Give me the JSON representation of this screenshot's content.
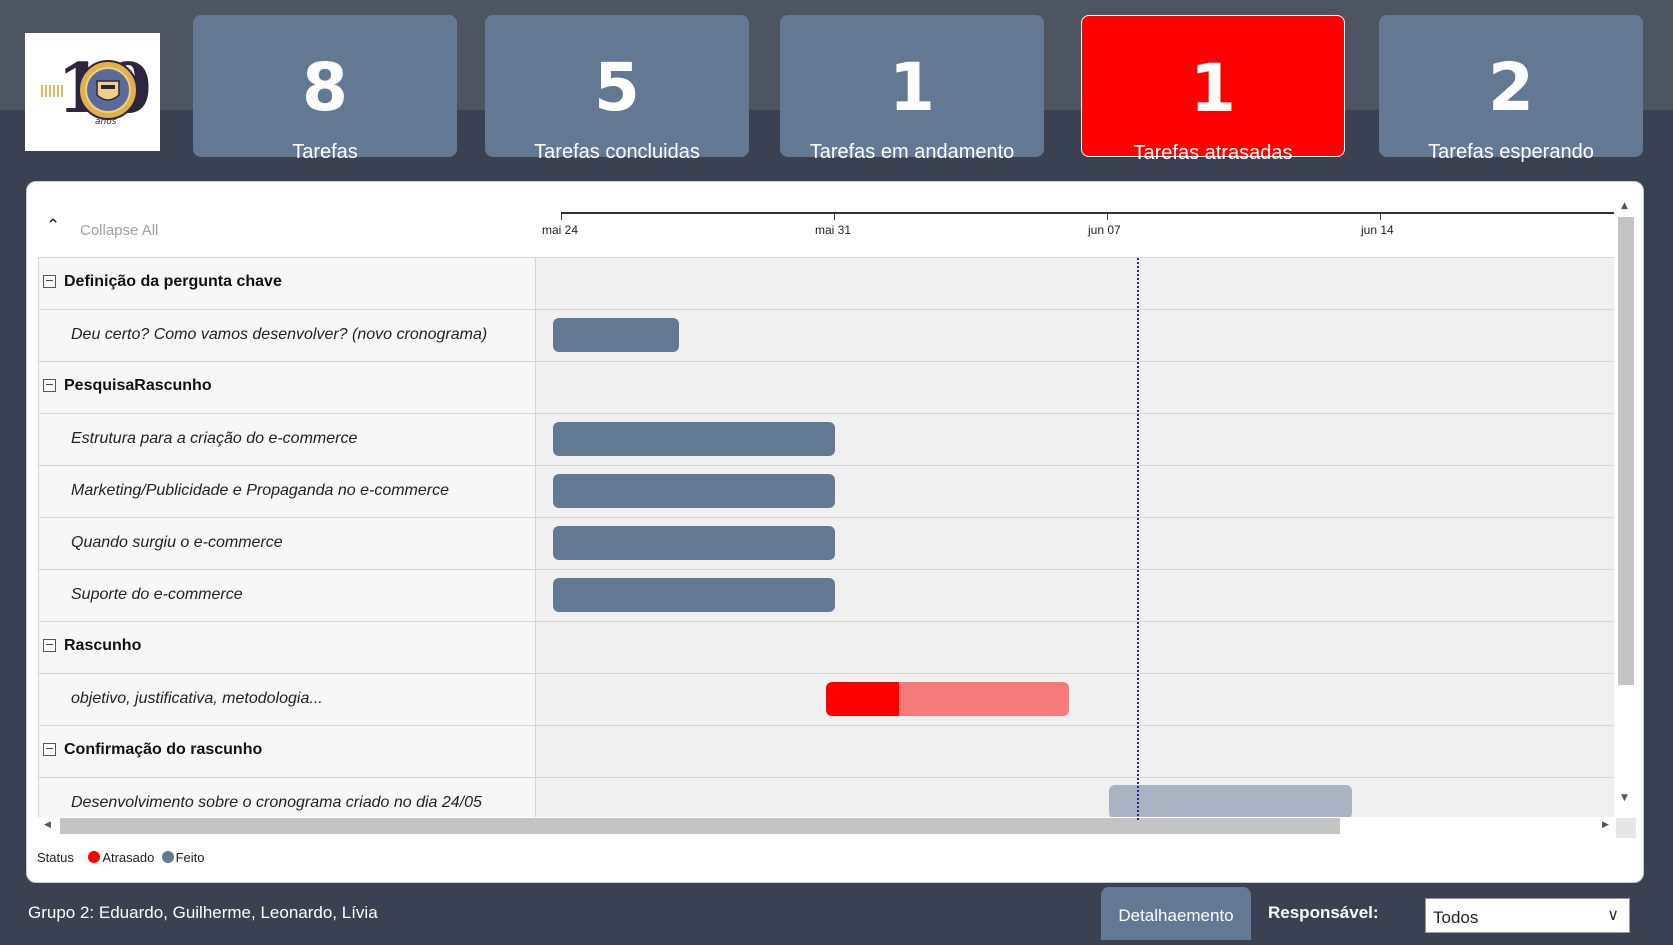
{
  "logo": {
    "number": "10",
    "subtext": "anos"
  },
  "kpis": [
    {
      "value": "8",
      "label": "Tarefas"
    },
    {
      "value": "5",
      "label": "Tarefas concluidas"
    },
    {
      "value": "1",
      "label": "Tarefas em andamento"
    },
    {
      "value": "1",
      "label": "Tarefas atrasadas"
    },
    {
      "value": "2",
      "label": "Tarefas esperando"
    }
  ],
  "gantt": {
    "collapse_label": "Collapse All",
    "axis_ticks": [
      "mai 24",
      "mai 31",
      "jun 07",
      "jun 14"
    ],
    "groups": [
      {
        "name": "Definição da pergunta chave",
        "tasks": [
          "Deu certo? Como vamos desenvolver? (novo cronograma)"
        ]
      },
      {
        "name": "PesquisaRascunho",
        "tasks": [
          "Estrutura para a criação do e-commerce",
          "Marketing/Publicidade e Propaganda no e-commerce",
          "Quando surgiu o e-commerce",
          "Suporte do e-commerce"
        ]
      },
      {
        "name": "Rascunho",
        "tasks": [
          "objetivo, justificativa, metodologia..."
        ]
      },
      {
        "name": "Confirmação do rascunho",
        "tasks": [
          "Desenvolvimento sobre o cronograma criado no dia 24/05"
        ]
      }
    ],
    "legend": {
      "title": "Status",
      "items": [
        {
          "label": "Atrasado",
          "color": "#ff0000"
        },
        {
          "label": "Feito",
          "color": "#637993"
        }
      ]
    }
  },
  "footer": {
    "group_text": "Grupo 2: Eduardo, Guilherme, Leonardo, Lívia",
    "detail_button": "Detalhaemento",
    "responsible_label": "Responsável:",
    "responsible_value": "Todos"
  },
  "colors": {
    "kpi": "#637993",
    "alert": "#ff0000",
    "background": "#3a4150"
  }
}
